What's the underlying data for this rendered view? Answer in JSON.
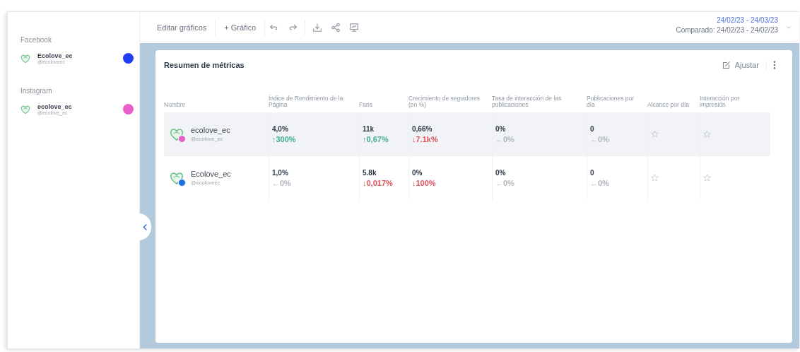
{
  "sidebar": {
    "groups": [
      {
        "title": "Facebook",
        "accounts": [
          {
            "name": "Ecolove_ec",
            "handle": "@ecoloveec",
            "color": "#1f3ff0"
          }
        ]
      },
      {
        "title": "Instagram",
        "accounts": [
          {
            "name": "ecolove_ec",
            "handle": "@ecolove_ec",
            "color": "#e85fcc"
          }
        ]
      }
    ]
  },
  "toolbar": {
    "buttons": [
      "Editar gráficos",
      "+ Gráfico"
    ],
    "date_range": "24/02/23 - 24/03/23",
    "compared": "Comparado: 24/02/23 - 24/02/23"
  },
  "card": {
    "title": "Resumen de métricas",
    "adjust_label": "Ajustar",
    "table": {
      "columns": [
        "Nombre",
        "Índice de Rendimiento de la Página",
        "Fans",
        "Crecimiento de seguidores (en %)",
        "Tasa de interacción de las publicaciones",
        "Publicaciones por día",
        "Alcance por día",
        "Interacción por impresión"
      ],
      "rows": [
        {
          "highlighted": true,
          "cells": [
            {
              "kind": "account",
              "name": "ecolove_ec",
              "handle": "@ecolove_ec",
              "color": "#e85fcc"
            },
            {
              "kind": "metric",
              "value": "4,0%",
              "change": "↑300%",
              "color": "#3fae8f"
            },
            {
              "kind": "metric",
              "value": "11k",
              "change": "↑0,67%",
              "color": "#3fae8f"
            },
            {
              "kind": "metric",
              "value": "0,66%",
              "change": "↓7.1k%",
              "color": "#e0505a"
            },
            {
              "kind": "metric",
              "value": "0%",
              "change": "←0%",
              "color": "#b0b6be"
            },
            {
              "kind": "metric",
              "value": "0",
              "change": "←0%",
              "color": "#b0b6be"
            },
            {
              "kind": "star"
            },
            {
              "kind": "star"
            }
          ]
        },
        {
          "highlighted": false,
          "cells": [
            {
              "kind": "account",
              "name": "Ecolove_ec",
              "handle": "@ecoloveec",
              "color": "#1f6fe8"
            },
            {
              "kind": "metric",
              "value": "1,0%",
              "change": "←0%",
              "color": "#b0b6be"
            },
            {
              "kind": "metric",
              "value": "5.8k",
              "change": "↓0,017%",
              "color": "#e0505a"
            },
            {
              "kind": "metric",
              "value": "0%",
              "change": "↓100%",
              "color": "#e0505a"
            },
            {
              "kind": "metric",
              "value": "0%",
              "change": "←0%",
              "color": "#b0b6be"
            },
            {
              "kind": "metric",
              "value": "0",
              "change": "←0%",
              "color": "#b0b6be"
            },
            {
              "kind": "star"
            },
            {
              "kind": "star"
            }
          ]
        }
      ]
    }
  }
}
